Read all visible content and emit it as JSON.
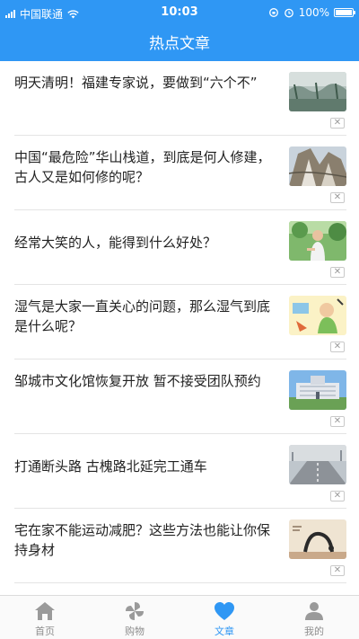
{
  "status_bar": {
    "carrier": "中国联通",
    "time": "10:03",
    "battery": "100%"
  },
  "header": {
    "title": "热点文章"
  },
  "articles": [
    {
      "title": "明天清明！福建专家说，要做到“六个不”",
      "thumb": "misty-landscape-thumbnail"
    },
    {
      "title": "中国“最危险”华山栈道，到底是何人修建，古人又是如何修的呢？",
      "thumb": "mountain-cliff-thumbnail"
    },
    {
      "title": "经常大笑的人，能得到什么好处？",
      "thumb": "laughing-man-thumbnail"
    },
    {
      "title": "湿气是大家一直关心的问题，那么湿气到底是什么呢？",
      "thumb": "cartoon-illustration-thumbnail"
    },
    {
      "title": "邹城市文化馆恢复开放 暂不接受团队预约",
      "thumb": "building-thumbnail"
    },
    {
      "title": "打通断头路 古槐路北延完工通车",
      "thumb": "road-thumbnail"
    },
    {
      "title": "宅在家不能运动减肥？这些方法也能让你保持身材",
      "thumb": "yoga-pose-thumbnail"
    }
  ],
  "close_glyph": "✕",
  "tabbar": {
    "tabs": [
      {
        "label": "首页",
        "icon": "home-icon"
      },
      {
        "label": "购物",
        "icon": "pinwheel-icon"
      },
      {
        "label": "文章",
        "icon": "heart-icon"
      },
      {
        "label": "我的",
        "icon": "user-icon"
      }
    ],
    "active_index": 2
  },
  "colors": {
    "accent": "#2f97f4",
    "inactive": "#8e8e8e"
  }
}
